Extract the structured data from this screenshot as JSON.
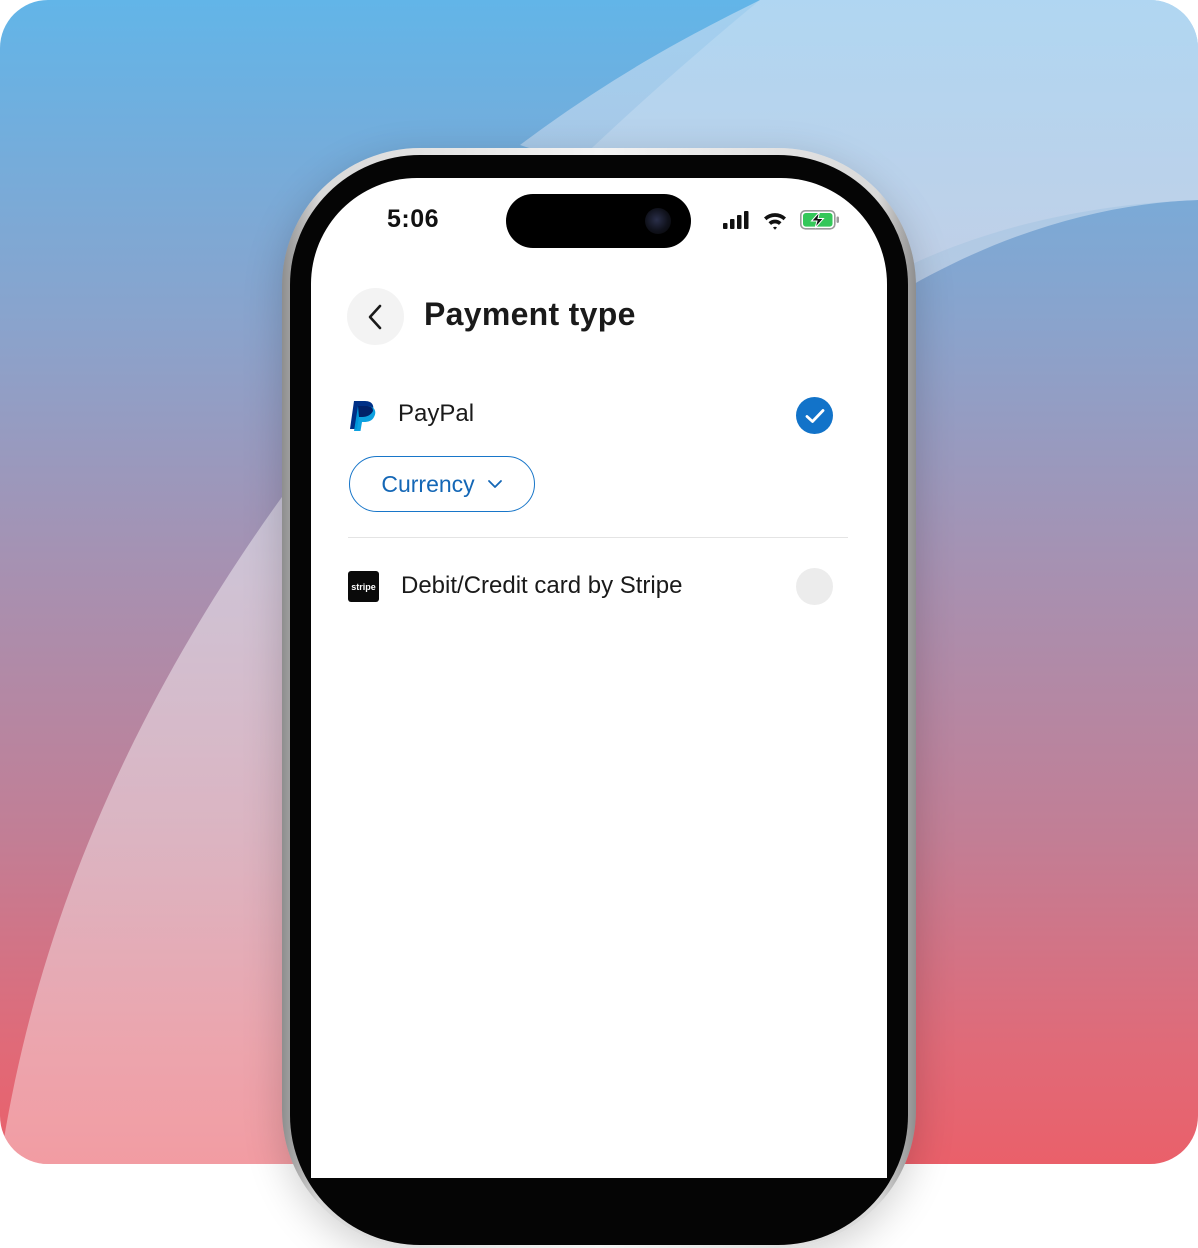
{
  "status_bar": {
    "time": "5:06"
  },
  "header": {
    "title": "Payment type",
    "back_icon": "chevron-left-icon"
  },
  "payment_options": [
    {
      "label": "PayPal",
      "logo": "paypal-logo",
      "selected": true
    },
    {
      "label": "Debit/Credit card by Stripe",
      "logo": "stripe-logo",
      "logo_text": "stripe",
      "selected": false
    }
  ],
  "currency_button": {
    "label": "Currency",
    "icon": "chevron-down-icon"
  },
  "colors": {
    "accent": "#1273c9",
    "accent_text": "#1467b6",
    "unselected": "#ececec",
    "battery_green": "#34c759"
  }
}
